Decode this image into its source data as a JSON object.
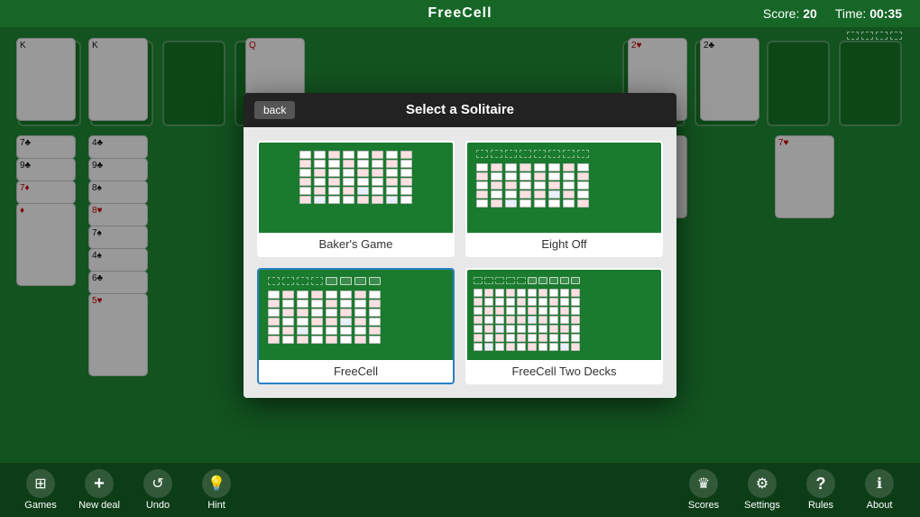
{
  "header": {
    "title": "FreeCell",
    "score_label": "Score:",
    "score_value": "20",
    "time_label": "Time:",
    "time_value": "00:35"
  },
  "modal": {
    "title": "Select a Solitaire",
    "back_label": "back",
    "options": [
      {
        "id": "bakers-game",
        "label": "Baker's Game",
        "selected": false
      },
      {
        "id": "eight-off",
        "label": "Eight Off",
        "selected": false
      },
      {
        "id": "freecell",
        "label": "FreeCell",
        "selected": true
      },
      {
        "id": "freecell-two-decks",
        "label": "FreeCell Two Decks",
        "selected": false
      }
    ]
  },
  "bottom_bar": {
    "left_buttons": [
      {
        "id": "games",
        "label": "Games",
        "icon": "⊞"
      },
      {
        "id": "new-deal",
        "label": "New deal",
        "icon": "+"
      },
      {
        "id": "undo",
        "label": "Undo",
        "icon": "↺"
      },
      {
        "id": "hint",
        "label": "Hint",
        "icon": "💡"
      }
    ],
    "right_buttons": [
      {
        "id": "scores",
        "label": "Scores",
        "icon": "♛"
      },
      {
        "id": "settings",
        "label": "Settings",
        "icon": "⚙"
      },
      {
        "id": "rules",
        "label": "Rules",
        "icon": "?"
      },
      {
        "id": "about",
        "label": "About",
        "icon": "ℹ"
      }
    ]
  }
}
